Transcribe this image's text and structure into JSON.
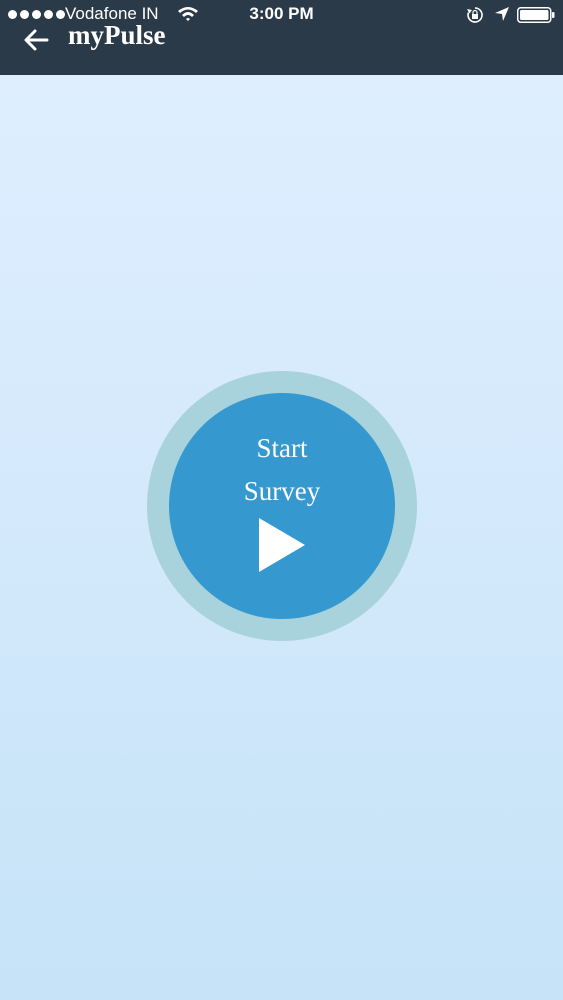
{
  "status_bar": {
    "carrier": "Vodafone IN",
    "time": "3:00 PM",
    "signal_bars": 5,
    "icons": [
      "wifi-icon",
      "rotation-lock-icon",
      "location-arrow-icon",
      "battery-icon"
    ]
  },
  "nav": {
    "title": "myPulse",
    "back_icon": "arrow-left-icon"
  },
  "survey": {
    "line1": "Start",
    "line2": "Survey",
    "icon": "play-icon"
  },
  "colors": {
    "topbar": "#2b3a48",
    "background_top": "#e0efff",
    "background_bottom": "#c6e3f7",
    "button_ring": "#a8d3dc",
    "button_fill": "#3599d0",
    "text": "#ffffff"
  }
}
